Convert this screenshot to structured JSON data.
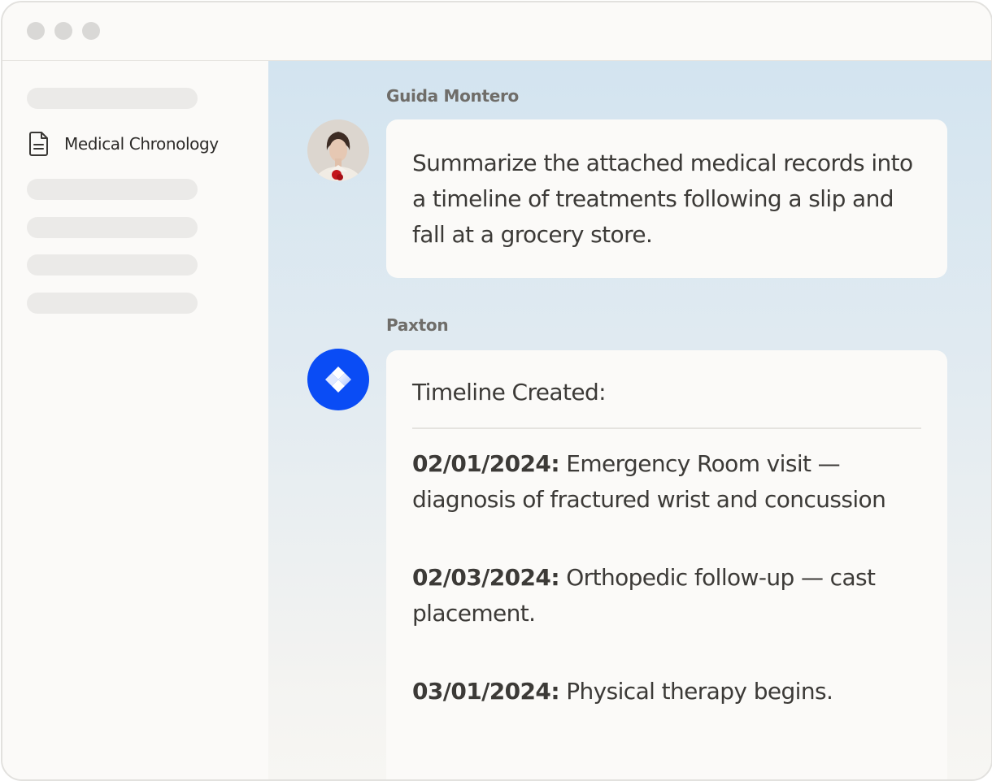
{
  "window": {
    "controls": [
      "dot",
      "dot",
      "dot"
    ]
  },
  "sidebar": {
    "active_item": {
      "icon": "document-icon",
      "label": "Medical Chronology"
    }
  },
  "chat": {
    "messages": [
      {
        "sender": "Guida Montero",
        "avatar": "user-avatar-photo",
        "text": "Summarize the attached medical records into a timeline of treatments following a slip and fall at a grocery store."
      },
      {
        "sender": "Paxton",
        "avatar": "paxton-logo-icon",
        "heading": "Timeline Created:",
        "entries": [
          {
            "date": "02/01/2024:",
            "text": " Emergency Room visit — diagnosis of fractured wrist and concussion"
          },
          {
            "date": "02/03/2024:",
            "text": " Orthopedic follow-up — cast placement."
          },
          {
            "date": "03/01/2024:",
            "text": " Physical therapy begins."
          }
        ]
      }
    ]
  },
  "colors": {
    "window_bg": "#fbfaf8",
    "skeleton": "#ebeae8",
    "brand_blue": "#0a4cf5",
    "text": "#3c3a37",
    "sender_text": "#6f6d69"
  }
}
